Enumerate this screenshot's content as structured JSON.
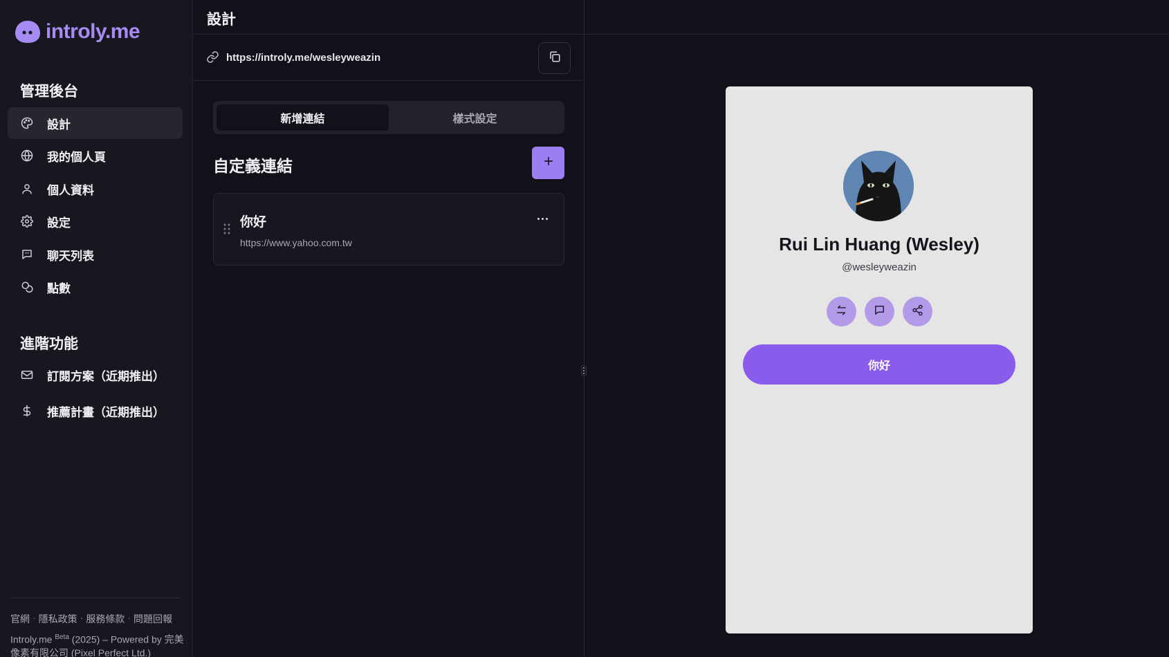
{
  "brand": {
    "logo_text": "introly.me",
    "accent": "#a68cf2"
  },
  "sidebar": {
    "admin_title": "管理後台",
    "items": [
      {
        "label": "設計",
        "icon": "palette-icon",
        "active": true
      },
      {
        "label": "我的個人頁",
        "icon": "globe-icon"
      },
      {
        "label": "個人資料",
        "icon": "user-icon"
      },
      {
        "label": "設定",
        "icon": "gear-icon"
      },
      {
        "label": "聊天列表",
        "icon": "chat-icon"
      },
      {
        "label": "點數",
        "icon": "coins-icon"
      }
    ],
    "advanced_title": "進階功能",
    "advanced_items": [
      {
        "label": "訂閱方案（近期推出）",
        "icon": "mail-icon"
      },
      {
        "label": "推薦計畫（近期推出）",
        "icon": "dollar-icon"
      }
    ],
    "footer": {
      "links": [
        "官網",
        "隱私政策",
        "服務條款",
        "問題回報"
      ],
      "separator": "·",
      "copyright_brand": "Introly.me",
      "copyright_badge": "Beta",
      "copyright_rest": "(2025) – Powered by 完美像素有限公司 (Pixel Perfect Ltd.)"
    }
  },
  "header": {
    "title": "設計"
  },
  "editor": {
    "profile_url": "https://introly.me/wesleyweazin",
    "tabs": [
      {
        "label": "新增連結",
        "active": true
      },
      {
        "label": "樣式設定",
        "active": false
      }
    ],
    "custom_links_title": "自定義連結",
    "links": [
      {
        "title": "你好",
        "url": "https://www.yahoo.com.tw"
      }
    ]
  },
  "preview": {
    "name": "Rui Lin Huang (Wesley)",
    "handle": "@wesleyweazin",
    "actions": [
      "swap-icon",
      "message-icon",
      "share-icon"
    ],
    "link_button_label": "你好",
    "button_color": "#8a5ceb",
    "card_background": "#e5e5e6"
  }
}
